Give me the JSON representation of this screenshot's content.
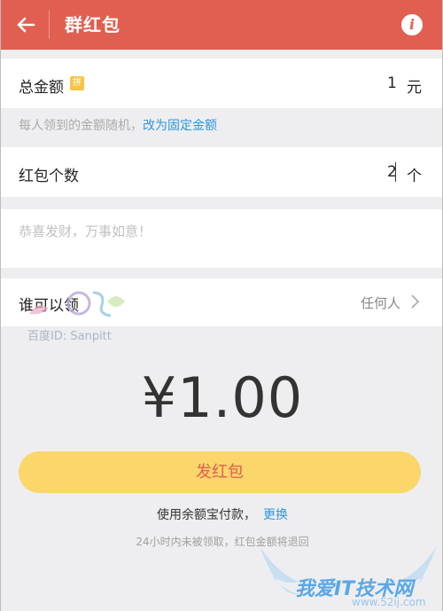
{
  "header": {
    "title": "群红包",
    "back_icon": "arrow-left-icon",
    "info_icon": "info-icon",
    "info_glyph": "i",
    "bg_color": "#e05f51"
  },
  "total_amount": {
    "label": "总金额",
    "badge": "拼",
    "value": "1",
    "unit": "元"
  },
  "hint": {
    "text": "每人领到的金额随机，",
    "link": "改为固定金额"
  },
  "count": {
    "label": "红包个数",
    "value": "2",
    "unit": "个"
  },
  "message": {
    "placeholder": "恭喜发财，万事如意！"
  },
  "who": {
    "label": "谁可以领",
    "value": "任何人"
  },
  "watermark": {
    "text": "百度ID: Sanpitt"
  },
  "amount_display": "¥1.00",
  "send_button": "发红包",
  "payment": {
    "text": "使用余额宝付款，",
    "change": "更换"
  },
  "note": "24小时内未被领取，红包金额将退回",
  "site": {
    "name": "我爱IT技术网",
    "url": "www.52ij.com"
  }
}
